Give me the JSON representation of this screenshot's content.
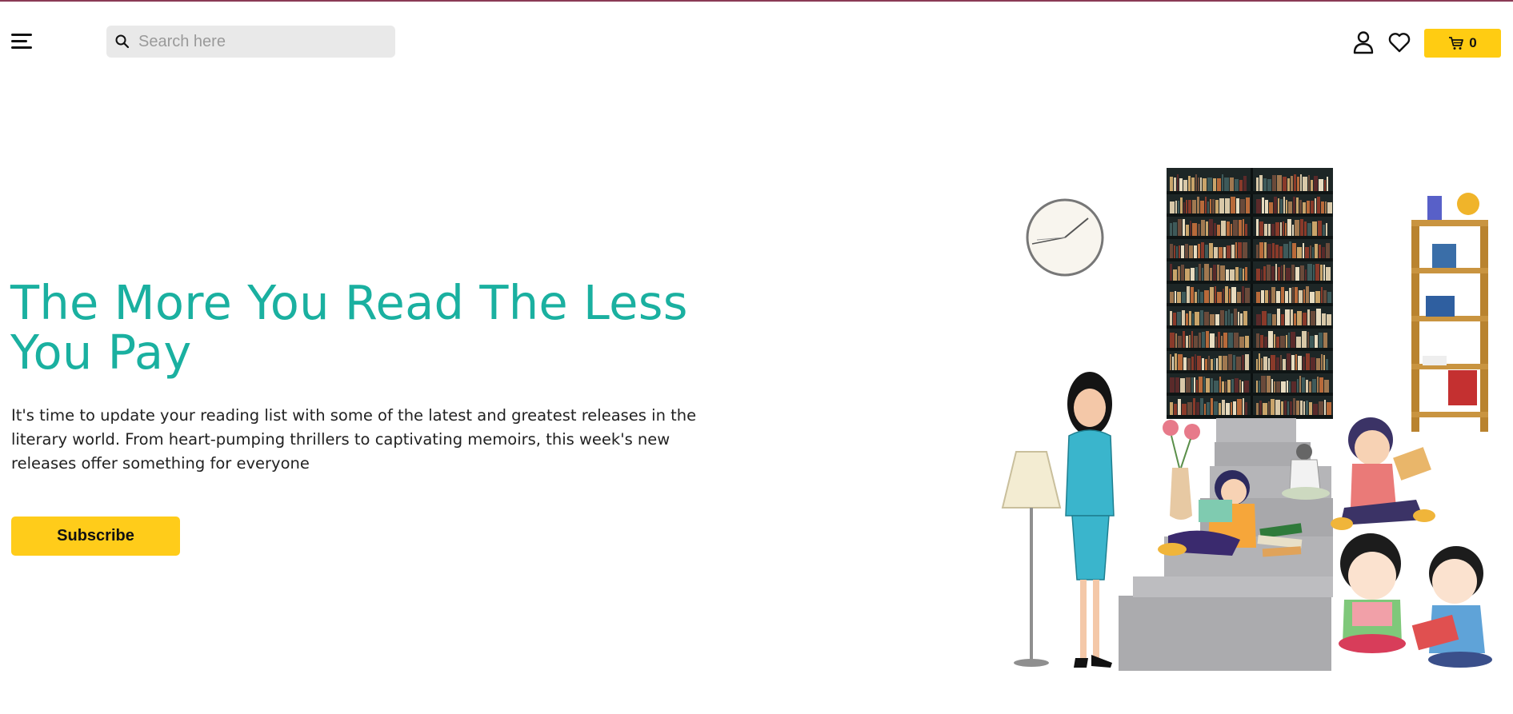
{
  "header": {
    "search_placeholder": "Search here",
    "cart_count": "0",
    "icons": [
      "hamburger-menu-icon",
      "search-icon",
      "user-icon",
      "heart-icon",
      "cart-icon"
    ]
  },
  "hero": {
    "title": "The More You Read The Less You Pay",
    "description": "It's time to update your reading list with some of the latest and greatest releases in the literary world. From heart-pumping thrillers to captivating memoirs, this week's new releases offer something for everyone",
    "subscribe_label": "Subscribe"
  },
  "colors": {
    "accent_teal": "#1ab0a0",
    "button_yellow": "#ffcc1a",
    "search_bg": "#e9e9e9",
    "top_border": "#8a3a55"
  }
}
